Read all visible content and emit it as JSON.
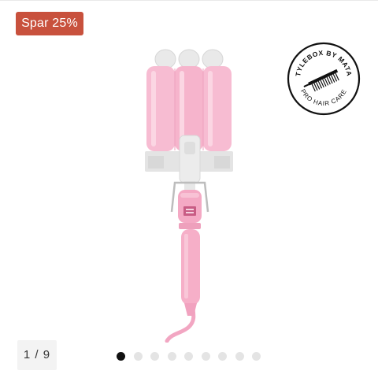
{
  "badge": {
    "label": "Spar 25%"
  },
  "seal": {
    "ring_text_top": "STYLEBOX BY MATAS",
    "ring_text_bottom": "PRO HAIR CARE",
    "logo_icon": "comb-icon"
  },
  "gallery": {
    "counter": "1 / 9",
    "current_index": 1,
    "total": 9,
    "dots": [
      {
        "label": "image 1",
        "active": true
      },
      {
        "label": "image 2",
        "active": false
      },
      {
        "label": "image 3",
        "active": false
      },
      {
        "label": "image 4",
        "active": false
      },
      {
        "label": "image 5",
        "active": false
      },
      {
        "label": "image 6",
        "active": false
      },
      {
        "label": "image 7",
        "active": false
      },
      {
        "label": "image 8",
        "active": false
      },
      {
        "label": "image 9",
        "active": false
      }
    ]
  },
  "colors": {
    "badge_bg": "#c8513d",
    "product_pink": "#f7b9cf",
    "product_grey": "#e6e6e6",
    "dot_active": "#111111",
    "dot_inactive": "#e4e4e4"
  }
}
